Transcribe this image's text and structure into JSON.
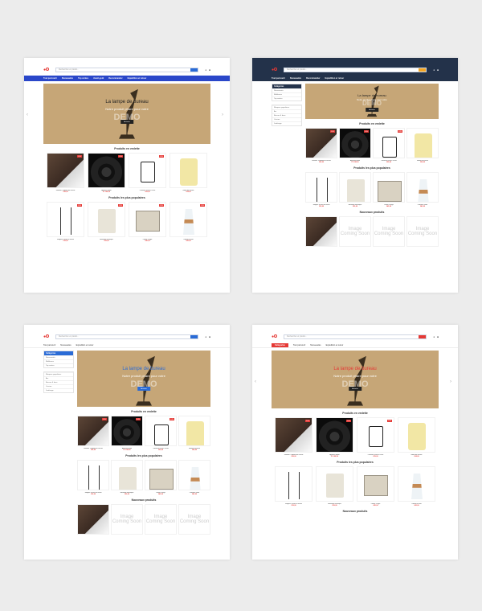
{
  "banner": {
    "title": "La lampe de bureau",
    "subtitle": "Notre produit phare pour votre",
    "watermark": "DEMO",
    "button": "Acheter"
  },
  "sections": {
    "sale": "Produits en vedette",
    "popular": "Produits les plus populaires",
    "new": "Nouveaux produits"
  },
  "placeholder": "Image Coming Soon",
  "badge": "-10%",
  "nav": {
    "items": [
      "Tout parcourir",
      "Nouveautés",
      "Top ventes",
      "Avant-goût",
      "Recommander",
      "Expédition et retour"
    ],
    "category_button": "Catégories"
  },
  "search": {
    "placeholder": "Rechercher un produit..."
  },
  "sidebar": {
    "cat_title": "Catégories",
    "cat_items": [
      "Nouveautés",
      "Meilleures",
      "Top ventes"
    ],
    "brand_title": "Marques populaires",
    "brand_items": [
      "Arc",
      "Basses & bass",
      "Cuisine",
      "Jardinage"
    ]
  },
  "products_sale": [
    {
      "name": "Sneaker Tradition de course",
      "price": "€38,00"
    },
    {
      "name": "Appareil photo",
      "price": "€1.199,00"
    },
    {
      "name": "Cafetière French Press",
      "price": "€29,00"
    },
    {
      "name": "Bidon de lessive",
      "price": "€24,00"
    }
  ],
  "products_popular": [
    {
      "name": "Étagère à fruits en métal",
      "price": "€18,00"
    },
    {
      "name": "Bouilloire électrique",
      "price": "€59,00"
    },
    {
      "name": "Panier à linge",
      "price": "€45,00"
    },
    {
      "name": "Cafetière verre",
      "price": "€42,00"
    }
  ]
}
